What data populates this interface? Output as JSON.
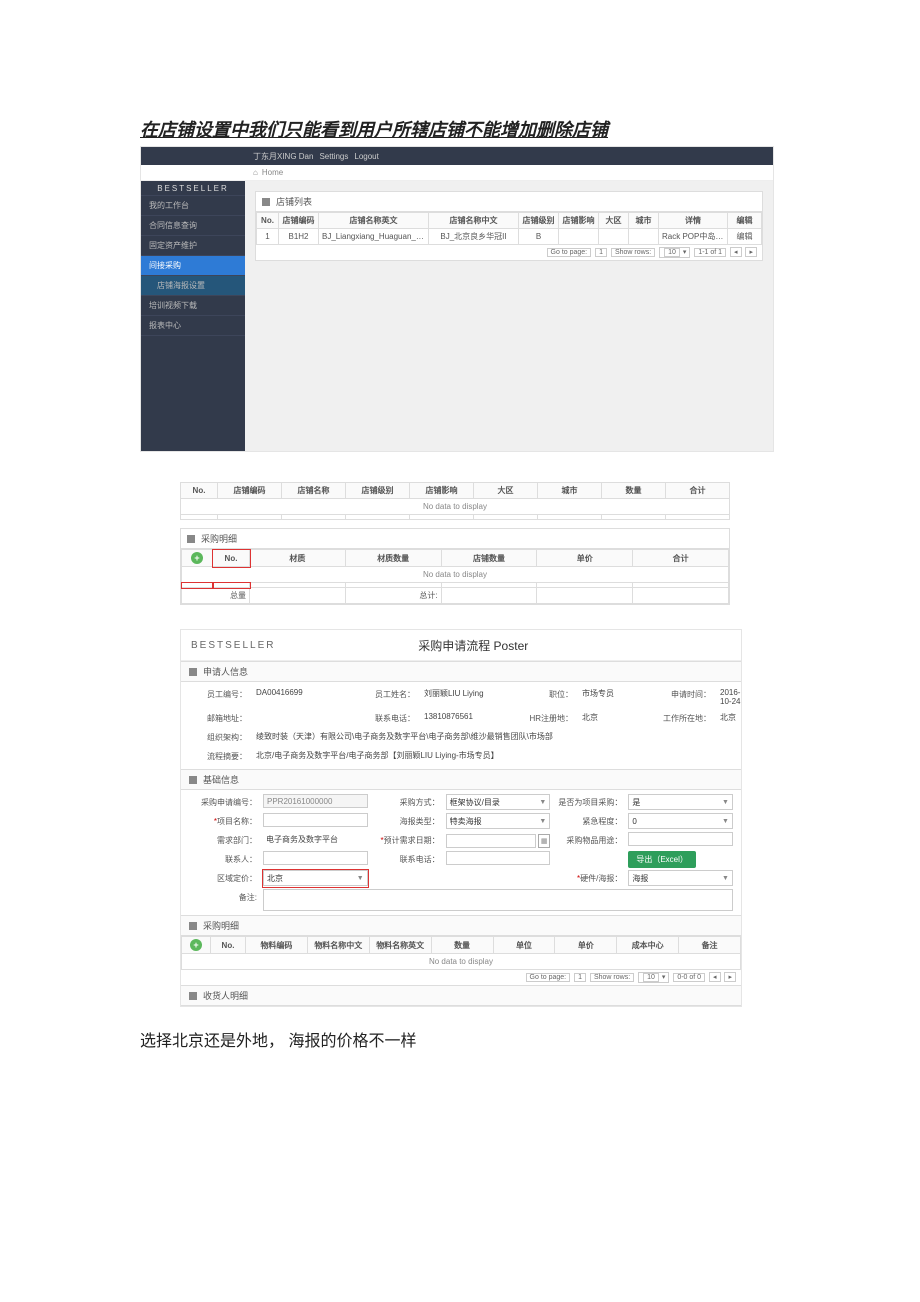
{
  "caption_top": "在店铺设置中我们只能看到用户所辖店铺不能增加删除店铺",
  "screenshot1": {
    "topbar": {
      "user": "丁东月XING Dan",
      "settings": "Settings",
      "logout": "Logout"
    },
    "brand": "BESTSELLER",
    "breadcrumb_home": "Home",
    "nav": [
      {
        "label": "我的工作台",
        "active": false
      },
      {
        "label": "合同信息查询",
        "active": false
      },
      {
        "label": "固定资产维护",
        "active": false
      },
      {
        "label": "间接采购",
        "active": true
      },
      {
        "label": "店铺海报设置",
        "sub": true
      },
      {
        "label": "培训视频下载",
        "active": false
      },
      {
        "label": "报表中心",
        "active": false
      }
    ],
    "panel_title": "店铺列表",
    "columns": [
      "No.",
      "店铺编码",
      "店铺名称英文",
      "店铺名称中文",
      "店铺级别",
      "店铺影响",
      "大区",
      "城市",
      "详情",
      "编辑"
    ],
    "row": {
      "no": "1",
      "code": "B1H2",
      "name_en": "BJ_Liangxiang_Huaguan_JACK...",
      "name_cn": "BJ_北京良乡华冠II",
      "level": "B",
      "impact": "",
      "region": "",
      "city": "",
      "detail": "Rack POP中岛架,on Glass Poster贴在玻璃上,Fac...",
      "edit": "编辑"
    },
    "pager": {
      "goto": "Go to page:",
      "page": "1",
      "showrows": "Show rows:",
      "rows": "10",
      "range": "1-1 of 1"
    }
  },
  "block2": {
    "table1_cols": [
      "No.",
      "店铺编码",
      "店铺名称",
      "店铺级别",
      "店铺影响",
      "大区",
      "城市",
      "数量",
      "合计"
    ],
    "no_data": "No data to display",
    "panel_title": "采购明细",
    "table2_cols": [
      "No.",
      "材质",
      "材质数量",
      "店铺数量",
      "单价",
      "合计"
    ],
    "footer": {
      "total_label": "总量",
      "sum_label": "总计:"
    }
  },
  "screenshot3": {
    "brand": "BESTSELLER",
    "title": "采购申请流程 Poster",
    "section_applicant": "申请人信息",
    "applicant": {
      "emp_id_lbl": "员工编号：",
      "emp_id": "DA00416699",
      "emp_name_lbl": "员工姓名：",
      "emp_name": "刘丽颖LIU Liying",
      "position_lbl": "职位：",
      "position": "市场专员",
      "apply_time_lbl": "申请时间：",
      "apply_time": "2016-10-24",
      "email_lbl": "邮箱地址：",
      "email": "",
      "phone_lbl": "联系电话：",
      "phone": "13810876561",
      "hr_loc_lbl": "HR注册地：",
      "hr_loc": "北京",
      "work_loc_lbl": "工作所在地：",
      "work_loc": "北京",
      "org_lbl": "组织架构：",
      "org": "绫致时装（天津）有限公司\\电子商务及数字平台\\电子商务部\\维沙最销售团队\\市场部",
      "flow_lbl": "流程摘要：",
      "flow": "北京/电子商务及数字平台/电子商务部【刘丽颖LIU Liying-市场专员】"
    },
    "section_basic": "基础信息",
    "basic": {
      "req_no_lbl": "采购申请编号：",
      "req_no": "PPR20161000000",
      "method_lbl": "采购方式：",
      "method": "框架协议/目录",
      "is_proj_lbl": "是否为项目采购：",
      "is_proj": "是",
      "proj_name_lbl": "项目名称：",
      "poster_type_lbl": "海报类型：",
      "poster_type": "特卖海报",
      "urgency_lbl": "紧急程度：",
      "urgency": "0",
      "dept_lbl": "需求部门：",
      "dept": "电子商务及数字平台",
      "date_lbl": "预计需求日期：",
      "usage_lbl": "采购物品用途：",
      "contact_lbl": "联系人：",
      "contact_phone_lbl": "联系电话：",
      "export_btn": "导出（Excel）",
      "region_price_lbl": "区域定价：",
      "region_price": "北京",
      "hw_poster_lbl": "硬件/海报：",
      "hw_poster": "海报",
      "remark_lbl": "备注:"
    },
    "section_detail": "采购明细",
    "detail_cols": [
      "No.",
      "物料编码",
      "物料名称中文",
      "物料名称英文",
      "数量",
      "单位",
      "单价",
      "成本中心",
      "备注"
    ],
    "no_data": "No data to display",
    "pager": {
      "goto": "Go to page:",
      "page": "1",
      "showrows": "Show rows:",
      "rows": "10",
      "range": "0-0 of 0"
    },
    "section_receiver": "收货人明细"
  },
  "note_bottom": "选择北京还是外地，  海报的价格不一样"
}
